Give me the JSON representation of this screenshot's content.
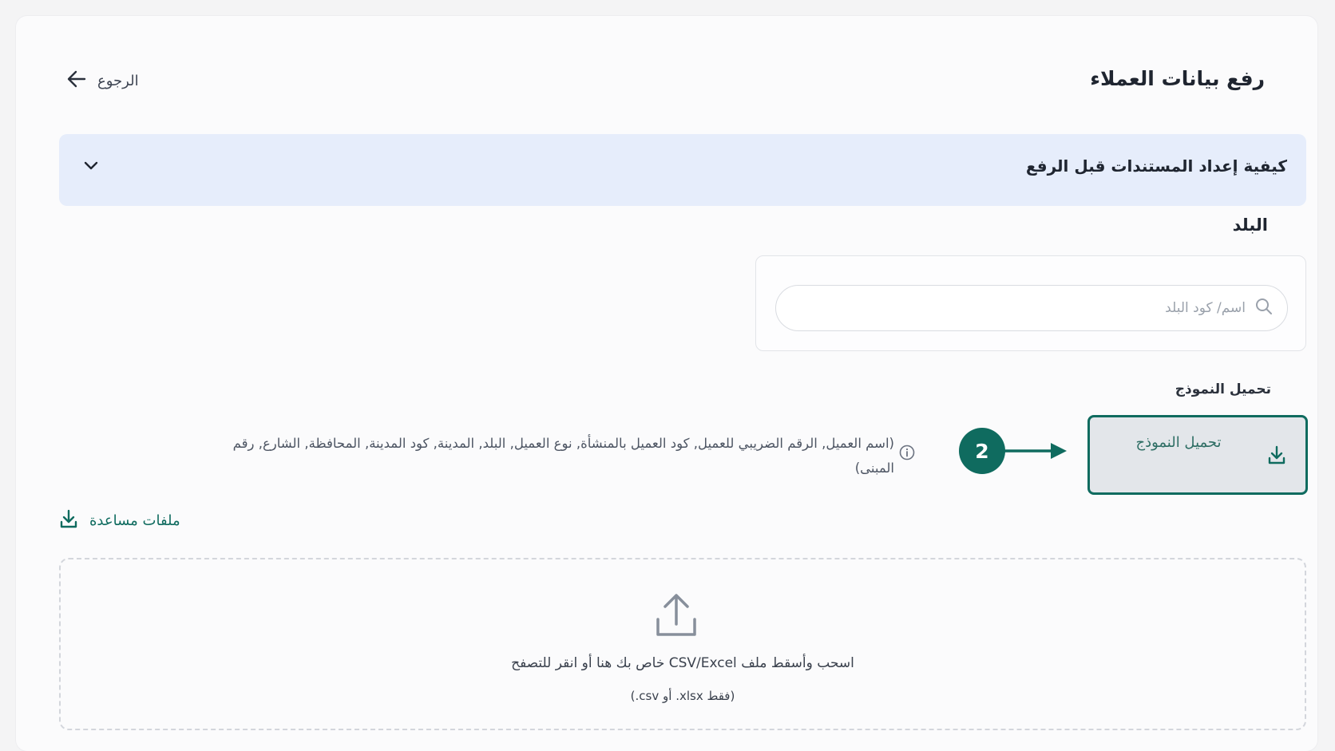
{
  "header": {
    "title": "رفع بيانات العملاء",
    "back_label": "الرجوع"
  },
  "accordion": {
    "title": "كيفية إعداد المستندات قبل الرفع"
  },
  "country": {
    "label": "البلد",
    "search_placeholder": "اسم/ كود البلد"
  },
  "template": {
    "section_label": "تحميل النموذج",
    "button_label": "تحميل النموذج",
    "step_number": "2",
    "fields_info": "(اسم العميل, الرقم الضريبي للعميل, كود العميل بالمنشأة, نوع العميل, البلد, المدينة, كود المدينة, المحافظة, الشارع, رقم المبنى)"
  },
  "help": {
    "label": "ملفات مساعدة"
  },
  "dropzone": {
    "main_text": "اسحب وأسقط ملف CSV/Excel خاص بك هنا أو انقر للتصفح",
    "sub_text": "(.csv أو .xlsx فقط)"
  },
  "colors": {
    "accent": "#0f6b5f",
    "accordion_bg": "#e6edfb",
    "button_bg": "#e3e6ea"
  },
  "icons": {
    "back": "arrow-left-icon",
    "accordion": "chevron-down-icon",
    "search": "search-icon",
    "download": "download-icon",
    "info": "info-icon",
    "upload": "upload-icon"
  }
}
